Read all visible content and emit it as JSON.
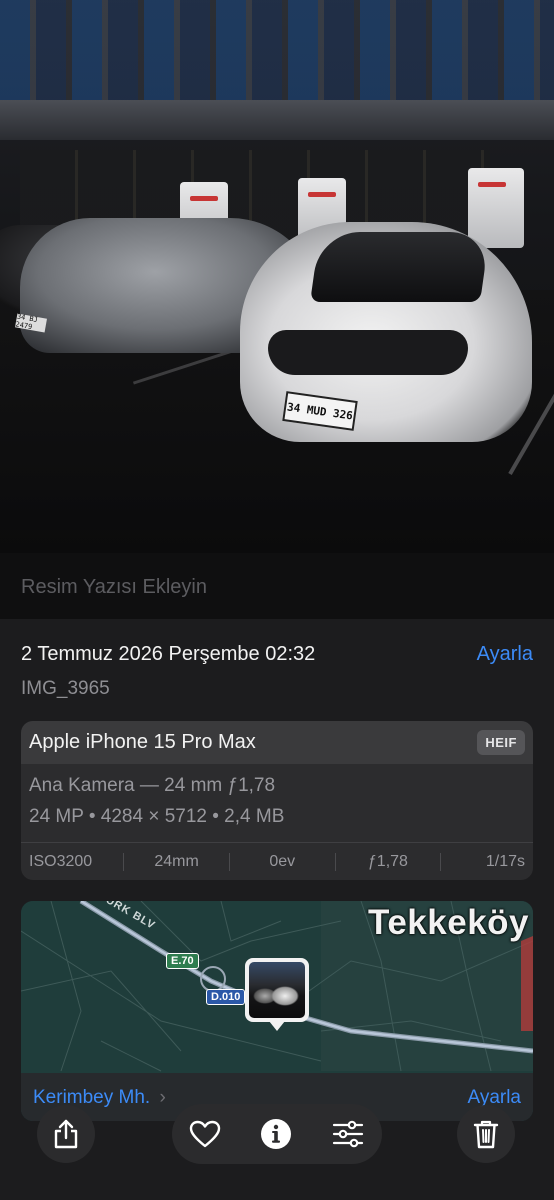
{
  "photo": {
    "plate_front": "34 MUD 326",
    "plate_side": "34 BJ 2479"
  },
  "caption": {
    "placeholder": "Resim Yazısı Ekleyin"
  },
  "info": {
    "date": "2 Temmuz 2026 Perşembe 02:32",
    "adjust_label": "Ayarla",
    "filename": "IMG_3965"
  },
  "camera_card": {
    "device": "Apple iPhone 15 Pro Max",
    "format_badge": "HEIF",
    "lens": "Ana Kamera — 24 mm ƒ1,78",
    "specs": "24 MP • 4284 × 5712 • 2,4 MB",
    "exif": [
      "ISO3200",
      "24mm",
      "0ev",
      "ƒ1,78",
      "1/17s"
    ]
  },
  "map": {
    "area_label": "Tekkeköy",
    "street_label": "URK BLV",
    "road_e70": "E.70",
    "road_d010": "D.010",
    "place": "Kerimbey Mh.",
    "place_chevron": "›",
    "adjust_label": "Ayarla"
  },
  "colors": {
    "accent": "#3c8bf7",
    "background": "#1c1c1e",
    "card": "#2c2c2e"
  },
  "toolbar": {
    "icons": [
      "share-icon",
      "heart-icon",
      "info-icon",
      "adjust-icon",
      "trash-icon"
    ]
  }
}
